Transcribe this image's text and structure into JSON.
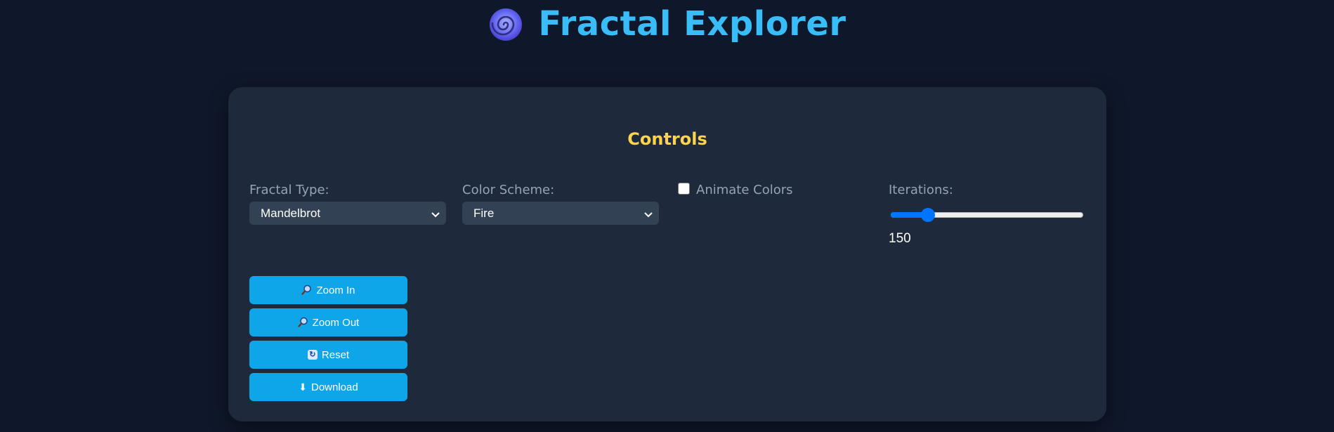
{
  "app": {
    "title": "Fractal Explorer",
    "logo_icon": "cyclone-icon"
  },
  "controls": {
    "heading": "Controls",
    "fractal_type": {
      "label": "Fractal Type:",
      "value": "Mandelbrot"
    },
    "color_scheme": {
      "label": "Color Scheme:",
      "value": "Fire"
    },
    "animate_colors": {
      "label": "Animate Colors",
      "checked": false
    },
    "iterations": {
      "label": "Iterations:",
      "value": "150",
      "slider_fraction": 0.17
    }
  },
  "buttons": {
    "zoom_in": {
      "label": "Zoom In",
      "icon": "magnifier-left-icon"
    },
    "zoom_out": {
      "label": "Zoom Out",
      "icon": "magnifier-right-icon"
    },
    "reset": {
      "label": "Reset",
      "icon": "refresh-icon"
    },
    "download": {
      "label": "Download",
      "icon": "down-arrow-icon"
    }
  },
  "colors": {
    "background": "#0f172a",
    "panel": "#1e293b",
    "title": "#38bdf8",
    "heading": "#fcd34d",
    "button": "#0ea5e9",
    "slider_accent": "#0075ff"
  }
}
